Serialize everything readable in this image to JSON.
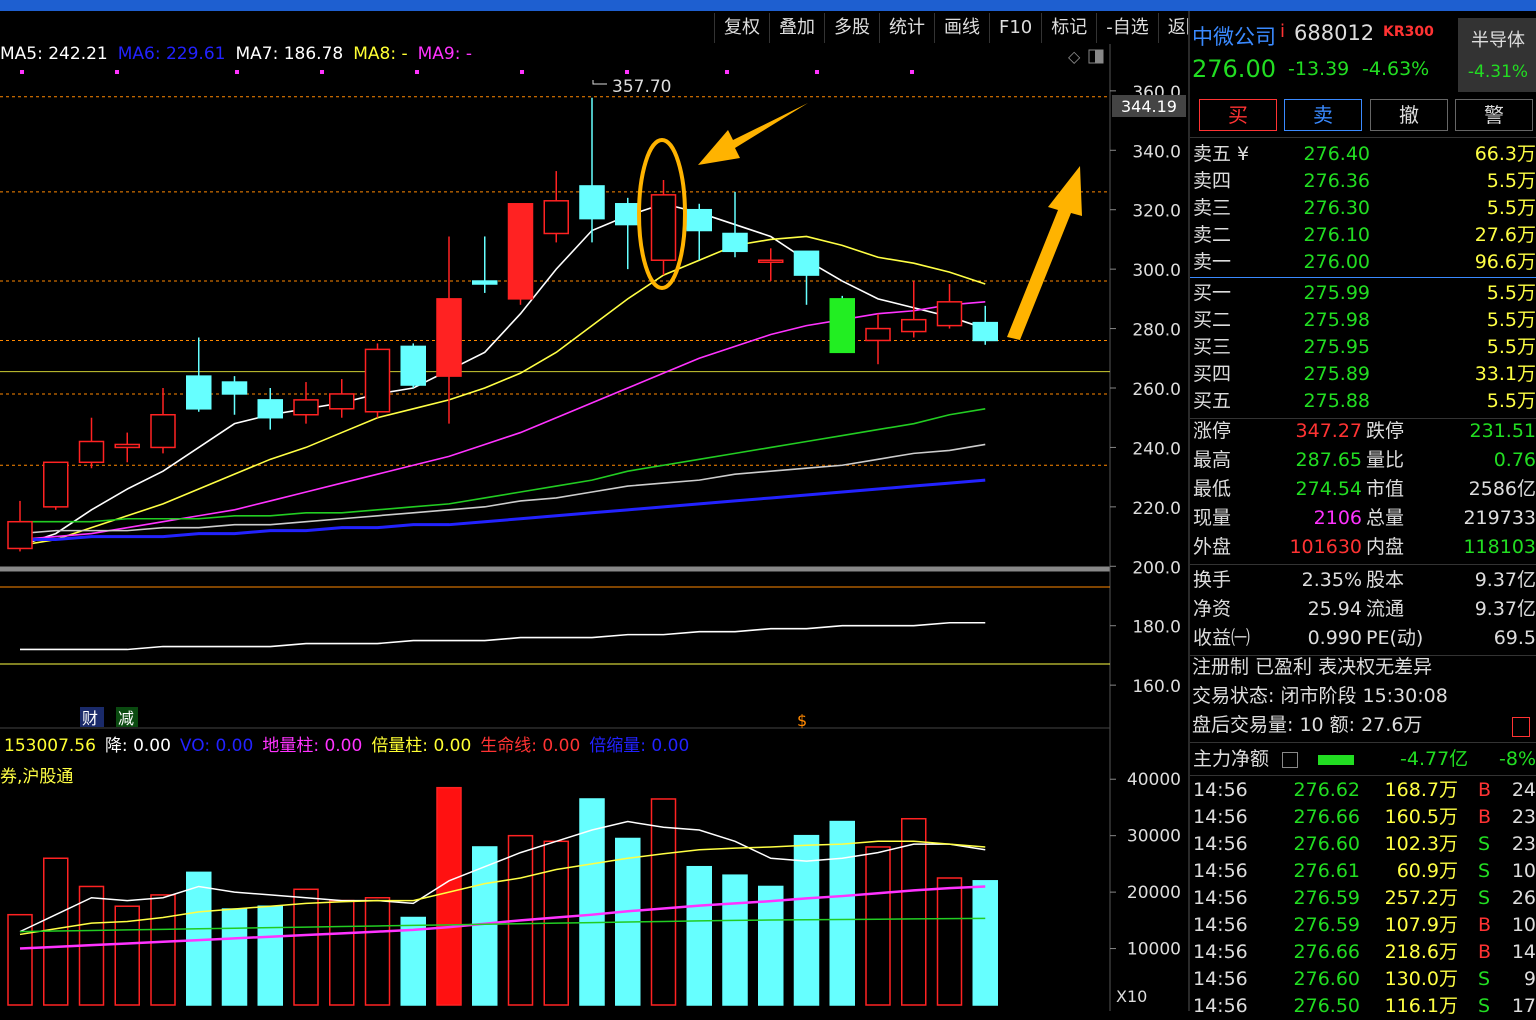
{
  "toolbar": [
    "复权",
    "叠加",
    "多股",
    "统计",
    "画线",
    "F10",
    "标记",
    "-自选",
    "返回"
  ],
  "ma_legend": [
    {
      "label": "MA5: 242.21",
      "color": "#ffffff"
    },
    {
      "label": "MA6: 229.61",
      "color": "#2222ff"
    },
    {
      "label": "MA7: 186.78",
      "color": "#ffffff"
    },
    {
      "label": "MA8: -",
      "color": "#ffff33"
    },
    {
      "label": "MA9: -",
      "color": "#ff33ff"
    }
  ],
  "vol_legend": [
    {
      "label": "153007.56",
      "color": "#ffff33"
    },
    {
      "label": "降: 0.00",
      "color": "#ffffff"
    },
    {
      "label": "VO: 0.00",
      "color": "#2222ff"
    },
    {
      "label": "地量柱: 0.00",
      "color": "#ff33ff"
    },
    {
      "label": "倍量柱: 0.00",
      "color": "#ffff33"
    },
    {
      "label": "生命线: 0.00",
      "color": "#ff3333"
    },
    {
      "label": "倍缩量: 0.00",
      "color": "#2222ff"
    }
  ],
  "hugutong": "券,沪股通",
  "markers": {
    "cai": "财",
    "jian": "减",
    "s": "$",
    "peak": "357.70",
    "current_price_tag": "344.19",
    "x10": "X10"
  },
  "chart_data": [
    {
      "type": "candlestick",
      "title": "",
      "ylim": [
        155,
        365
      ],
      "yticks": [
        360,
        340,
        320,
        300,
        280,
        260,
        240,
        220,
        200,
        180,
        160
      ],
      "candles": [
        {
          "o": 206,
          "h": 222,
          "l": 205,
          "c": 215
        },
        {
          "o": 220,
          "h": 222,
          "l": 219,
          "c": 235
        },
        {
          "o": 235,
          "h": 250,
          "l": 233,
          "c": 242
        },
        {
          "o": 240,
          "h": 245,
          "l": 235,
          "c": 241
        },
        {
          "o": 240,
          "h": 260,
          "l": 238,
          "c": 251
        },
        {
          "o": 264,
          "h": 277,
          "l": 252,
          "c": 253
        },
        {
          "o": 262,
          "h": 264,
          "l": 251,
          "c": 258
        },
        {
          "o": 256,
          "h": 260,
          "l": 246,
          "c": 250
        },
        {
          "o": 251,
          "h": 262,
          "l": 248,
          "c": 256
        },
        {
          "o": 253,
          "h": 263,
          "l": 250,
          "c": 258
        },
        {
          "o": 252,
          "h": 275,
          "l": 250,
          "c": 273
        },
        {
          "o": 274,
          "h": 275,
          "l": 260,
          "c": 261
        },
        {
          "o": 264,
          "h": 311,
          "l": 248,
          "c": 290
        },
        {
          "o": 296,
          "h": 311,
          "l": 292,
          "c": 295
        },
        {
          "o": 290,
          "h": 322,
          "l": 288,
          "c": 322
        },
        {
          "o": 312,
          "h": 333,
          "l": 309,
          "c": 323
        },
        {
          "o": 328,
          "h": 357.7,
          "l": 309,
          "c": 317
        },
        {
          "o": 322,
          "h": 324,
          "l": 300,
          "c": 315
        },
        {
          "o": 303,
          "h": 330,
          "l": 298,
          "c": 325
        },
        {
          "o": 320,
          "h": 322,
          "l": 303,
          "c": 313
        },
        {
          "o": 312,
          "h": 326,
          "l": 304,
          "c": 306
        },
        {
          "o": 303,
          "h": 307,
          "l": 296,
          "c": 303
        },
        {
          "o": 306,
          "h": 306,
          "l": 288,
          "c": 298
        },
        {
          "o": 290,
          "h": 291,
          "l": 272,
          "c": 272
        },
        {
          "o": 276,
          "h": 285,
          "l": 268,
          "c": 280
        },
        {
          "o": 279,
          "h": 296,
          "l": 277,
          "c": 283
        },
        {
          "o": 281,
          "h": 295,
          "l": 280,
          "c": 289
        },
        {
          "o": 282,
          "h": 287.65,
          "l": 274.54,
          "c": 276
        }
      ],
      "ma_lines": [
        {
          "name": "MA5",
          "color": "#ffffff",
          "values": [
            207,
            211,
            219,
            226,
            232,
            240,
            248,
            251,
            253,
            255,
            258,
            260,
            266,
            272,
            285,
            300,
            313,
            318,
            322,
            319,
            315,
            311,
            303,
            296,
            290,
            287,
            284,
            280
          ]
        },
        {
          "name": "MA10",
          "color": "#ffff44",
          "values": [
            207,
            209,
            213,
            217,
            221,
            226,
            231,
            236,
            240,
            245,
            250,
            253,
            256,
            260,
            265,
            272,
            281,
            290,
            298,
            303,
            308,
            310,
            311,
            308,
            304,
            302,
            299,
            295
          ]
        },
        {
          "name": "MA20",
          "color": "#ff33ff",
          "values": [
            209,
            210,
            211,
            213,
            215,
            217,
            219,
            222,
            225,
            228,
            231,
            234,
            237,
            241,
            245,
            250,
            255,
            260,
            265,
            270,
            274,
            278,
            281,
            283,
            285,
            286,
            288,
            289
          ]
        },
        {
          "name": "MA30",
          "color": "#22cc22",
          "values": [
            215,
            215,
            215,
            216,
            216,
            216,
            217,
            217,
            218,
            218,
            219,
            220,
            221,
            223,
            225,
            227,
            229,
            232,
            234,
            236,
            238,
            240,
            242,
            244,
            246,
            248,
            251,
            253
          ]
        },
        {
          "name": "MA60",
          "color": "#cccccc",
          "values": [
            211,
            212,
            212,
            212,
            213,
            213,
            214,
            214,
            215,
            216,
            217,
            218,
            219,
            220,
            222,
            223,
            225,
            227,
            228,
            229,
            231,
            232,
            233,
            234,
            236,
            238,
            239,
            241
          ]
        },
        {
          "name": "MA120",
          "color": "#2222ff",
          "values": [
            209,
            209,
            210,
            210,
            210,
            211,
            211,
            212,
            212,
            213,
            213,
            214,
            214,
            215,
            216,
            217,
            218,
            219,
            220,
            221,
            222,
            223,
            224,
            225,
            226,
            227,
            228,
            229
          ]
        },
        {
          "name": "MA250",
          "color": "#ffffff",
          "values": [
            172,
            172,
            172,
            172,
            173,
            173,
            173,
            173,
            174,
            174,
            174,
            175,
            175,
            175,
            176,
            176,
            176,
            177,
            177,
            178,
            178,
            179,
            179,
            180,
            180,
            180,
            181,
            181
          ]
        }
      ],
      "h_lines": [
        358,
        326,
        296,
        276,
        265.5,
        258,
        234
      ]
    },
    {
      "type": "bar",
      "title": "volume",
      "ylim": [
        0,
        45000
      ],
      "yticks": [
        40000,
        30000,
        20000,
        10000
      ],
      "values": [
        16000,
        26000,
        21000,
        17500,
        19500,
        23500,
        17000,
        17500,
        20500,
        18500,
        19000,
        15500,
        38500,
        28000,
        30000,
        29000,
        36500,
        29500,
        36500,
        24500,
        23000,
        21000,
        30000,
        32500,
        28000,
        33000,
        22500,
        22000
      ],
      "up": [
        true,
        true,
        true,
        true,
        true,
        false,
        false,
        false,
        true,
        true,
        true,
        false,
        true,
        false,
        true,
        true,
        false,
        false,
        true,
        false,
        false,
        false,
        false,
        false,
        true,
        true,
        true,
        false
      ],
      "avg_lines": [
        {
          "name": "MAVOL5",
          "color": "#ffffff",
          "values": [
            13000,
            16000,
            19000,
            18500,
            19000,
            21000,
            20000,
            19500,
            19000,
            18500,
            18500,
            18000,
            22000,
            24500,
            27000,
            29000,
            31000,
            32500,
            31500,
            31000,
            29000,
            26000,
            25500,
            26000,
            27000,
            28500,
            28500,
            27500
          ]
        },
        {
          "name": "MAVOL10",
          "color": "#ffff44",
          "values": [
            12500,
            13500,
            14500,
            14800,
            15500,
            16500,
            17000,
            17500,
            18000,
            18300,
            18500,
            18500,
            20000,
            21500,
            22500,
            24000,
            25000,
            26000,
            26800,
            27500,
            27800,
            28000,
            28300,
            28500,
            29000,
            29000,
            28500,
            28000
          ]
        },
        {
          "name": "MAVOL20",
          "color": "#ff33ff",
          "values": [
            10000,
            10300,
            10600,
            10900,
            11200,
            11500,
            11800,
            12100,
            12400,
            12700,
            13000,
            13300,
            13800,
            14400,
            15000,
            15500,
            16000,
            16600,
            17100,
            17600,
            18000,
            18400,
            18900,
            19300,
            19800,
            20300,
            20700,
            21000
          ]
        },
        {
          "name": "MAVOL60",
          "color": "#22cc22",
          "values": [
            13000,
            13100,
            13200,
            13300,
            13400,
            13500,
            13600,
            13700,
            13800,
            13900,
            14000,
            14100,
            14200,
            14300,
            14400,
            14500,
            14600,
            14700,
            14800,
            14900,
            15000,
            15050,
            15100,
            15150,
            15200,
            15250,
            15300,
            15350
          ]
        }
      ]
    }
  ],
  "side": {
    "name": "中微公司",
    "code": "688012",
    "kr": "KR300",
    "sector": "半导体",
    "sector_chg": "-4.31%",
    "price": "276.00",
    "chg": "-13.39",
    "pct": "-4.63%",
    "buttons": {
      "buy": "买",
      "sell": "卖",
      "cancel": "撤",
      "alert": "警"
    },
    "asks": [
      {
        "label": "卖五 ¥",
        "price": "276.40",
        "vol": "66.3万"
      },
      {
        "label": "卖四",
        "price": "276.36",
        "vol": "5.5万"
      },
      {
        "label": "卖三",
        "price": "276.30",
        "vol": "5.5万"
      },
      {
        "label": "卖二",
        "price": "276.10",
        "vol": "27.6万"
      },
      {
        "label": "卖一",
        "price": "276.00",
        "vol": "96.6万"
      }
    ],
    "bids": [
      {
        "label": "买一",
        "price": "275.99",
        "vol": "5.5万"
      },
      {
        "label": "买二",
        "price": "275.98",
        "vol": "5.5万"
      },
      {
        "label": "买三",
        "price": "275.95",
        "vol": "5.5万"
      },
      {
        "label": "买四",
        "price": "275.89",
        "vol": "33.1万"
      },
      {
        "label": "买五",
        "price": "275.88",
        "vol": "5.5万"
      }
    ],
    "stats": [
      {
        "l1": "涨停",
        "v1": "347.27",
        "c1": "#ff3333",
        "l2": "跌停",
        "v2": "231.51",
        "c2": "#22dd22"
      },
      {
        "l1": "最高",
        "v1": "287.65",
        "c1": "#22dd22",
        "l2": "量比",
        "v2": "0.76",
        "c2": "#22dd22"
      },
      {
        "l1": "最低",
        "v1": "274.54",
        "c1": "#22dd22",
        "l2": "市值",
        "v2": "2586亿",
        "c2": "#dddddd"
      },
      {
        "l1": "现量",
        "v1": "2106",
        "c1": "#ff33ff",
        "l2": "总量",
        "v2": "219733",
        "c2": "#dddddd"
      },
      {
        "l1": "外盘",
        "v1": "101630",
        "c1": "#ff3333",
        "l2": "内盘",
        "v2": "118103",
        "c2": "#22dd22"
      }
    ],
    "stats2": [
      {
        "l1": "换手",
        "v1": "2.35%",
        "l2": "股本",
        "v2": "9.37亿"
      },
      {
        "l1": "净资",
        "v1": "25.94",
        "l2": "流通",
        "v2": "9.37亿"
      },
      {
        "l1": "收益㈠",
        "v1": "0.990",
        "l2": "PE(动)",
        "v2": "69.5"
      }
    ],
    "info": [
      "注册制 已盈利 表决权无差异",
      "交易状态: 闭市阶段 15:30:08",
      "盘后交易量: 10  额: 27.6万"
    ],
    "main_net": {
      "label": "主力净额",
      "value": "-4.77亿",
      "pct": "-8%"
    },
    "ticks": [
      {
        "t": "14:56",
        "p": "276.62",
        "a": "168.7万",
        "d": "B",
        "n": "24"
      },
      {
        "t": "14:56",
        "p": "276.66",
        "a": "160.5万",
        "d": "B",
        "n": "23"
      },
      {
        "t": "14:56",
        "p": "276.60",
        "a": "102.3万",
        "d": "S",
        "n": "23"
      },
      {
        "t": "14:56",
        "p": "276.61",
        "a": "60.9万",
        "d": "S",
        "n": "10"
      },
      {
        "t": "14:56",
        "p": "276.59",
        "a": "257.2万",
        "d": "S",
        "n": "26"
      },
      {
        "t": "14:56",
        "p": "276.59",
        "a": "107.9万",
        "d": "B",
        "n": "10"
      },
      {
        "t": "14:56",
        "p": "276.66",
        "a": "218.6万",
        "d": "B",
        "n": "14"
      },
      {
        "t": "14:56",
        "p": "276.60",
        "a": "130.0万",
        "d": "S",
        "n": "9"
      },
      {
        "t": "14:56",
        "p": "276.50",
        "a": "116.1万",
        "d": "S",
        "n": "17"
      }
    ]
  }
}
